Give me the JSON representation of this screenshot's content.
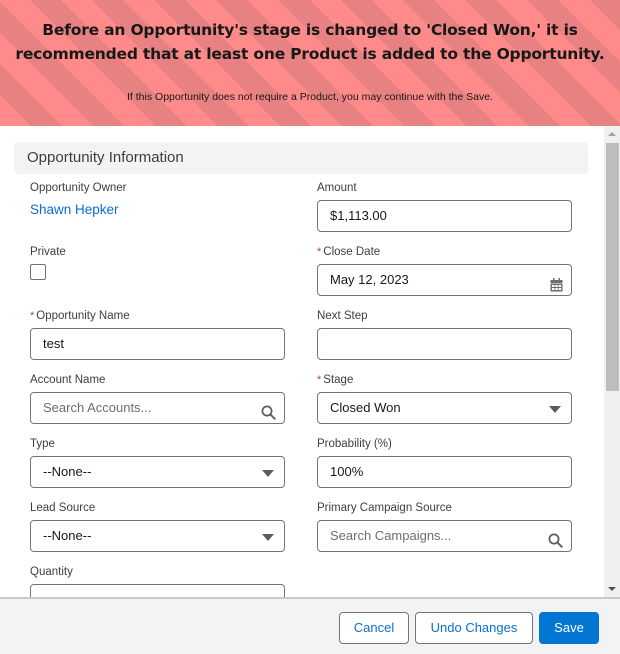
{
  "banner": {
    "headline_line1": "Before an Opportunity's stage is changed to 'Closed Won,' it is",
    "headline_line2": "recommended that at least one Product is added to the Opportunity.",
    "subtext": "If this Opportunity does not require a Product, you may continue with the Save.",
    "colors": {
      "stripe_light": "#ff8a8a",
      "stripe_dark": "#e88181"
    }
  },
  "section": {
    "title": "Opportunity Information"
  },
  "fields": {
    "owner": {
      "label": "Opportunity Owner",
      "value": "Shawn Hepker"
    },
    "amount": {
      "label": "Amount",
      "value": "$1,113.00"
    },
    "private": {
      "label": "Private",
      "checked": false
    },
    "close_date": {
      "label": "Close Date",
      "required": "*",
      "value": "May 12, 2023",
      "icon": "calendar-icon"
    },
    "opportunity_name": {
      "label": "Opportunity Name",
      "required": "*",
      "value": "test"
    },
    "next_step": {
      "label": "Next Step",
      "value": ""
    },
    "account_name": {
      "label": "Account Name",
      "placeholder": "Search Accounts...",
      "icon": "search-icon"
    },
    "stage": {
      "label": "Stage",
      "required": "*",
      "value": "Closed Won"
    },
    "type": {
      "label": "Type",
      "value": "--None--"
    },
    "probability": {
      "label": "Probability (%)",
      "value": "100%"
    },
    "lead_source": {
      "label": "Lead Source",
      "value": "--None--"
    },
    "primary_campaign": {
      "label": "Primary Campaign Source",
      "placeholder": "Search Campaigns...",
      "icon": "search-icon"
    },
    "quantity": {
      "label": "Quantity",
      "value": ""
    }
  },
  "footer": {
    "cancel_label": "Cancel",
    "undo_label": "Undo Changes",
    "save_label": "Save",
    "brand_color": "#0176d3"
  }
}
